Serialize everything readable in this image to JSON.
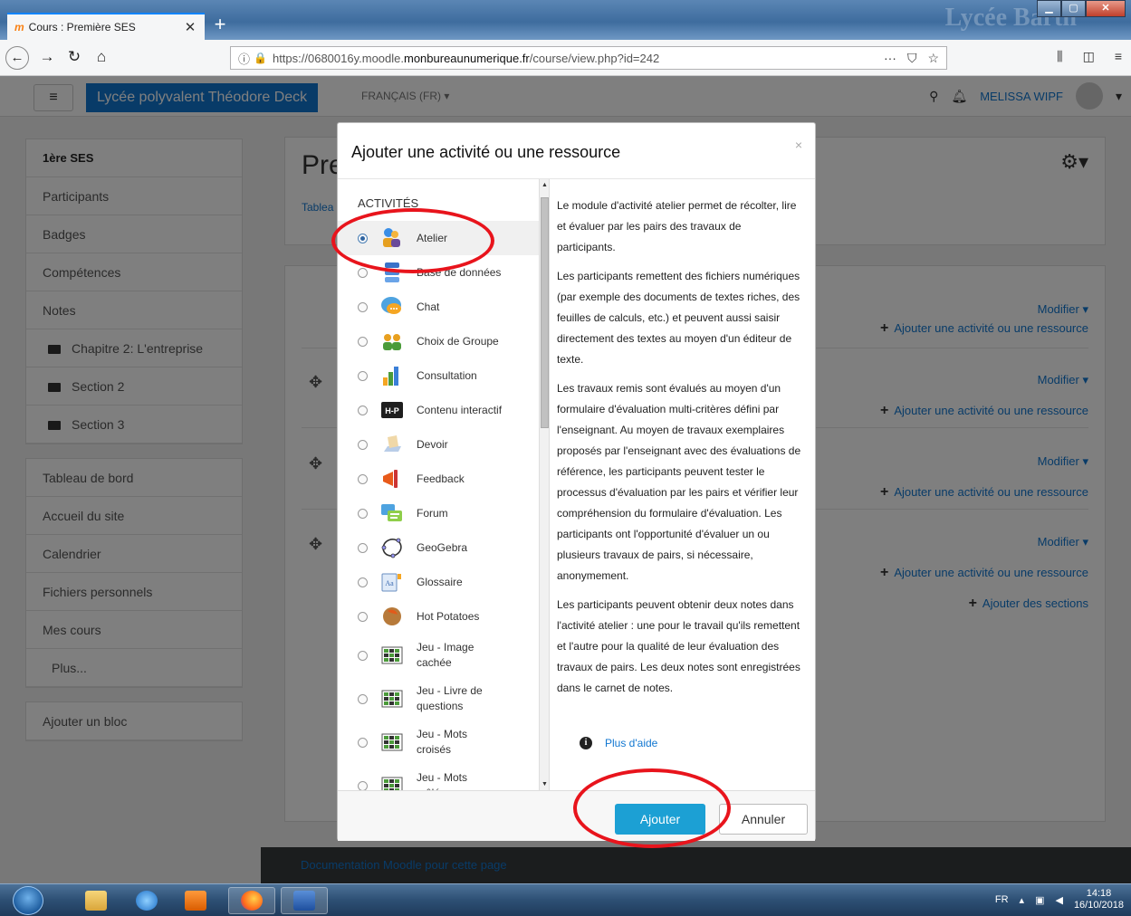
{
  "browser": {
    "tab_title": "Cours : Première SES",
    "tab_favicon": "m",
    "url_prefix": "https://0680016y.moodle.",
    "url_domain": "monbureaunumerique.fr",
    "url_path": "/course/view.php?id=242",
    "url_menu": "···",
    "watermark": "Lycée Barth"
  },
  "moodle": {
    "brand": "Lycée polyvalent Théodore Deck",
    "lang": "FRANÇAIS (FR) ▾",
    "user": "MELISSA WIPF",
    "page_title": "Pre",
    "breadcrumb": "Tablea",
    "footer_doc": "Documentation Moodle pour cette page",
    "sidebar_primary": [
      {
        "label": "1ère SES"
      },
      {
        "label": "Participants"
      },
      {
        "label": "Badges"
      },
      {
        "label": "Compétences"
      },
      {
        "label": "Notes"
      },
      {
        "label": "Chapitre 2: L'entreprise"
      },
      {
        "label": "Section 2"
      },
      {
        "label": "Section 3"
      }
    ],
    "sidebar_secondary": [
      {
        "label": "Tableau de bord"
      },
      {
        "label": "Accueil du site"
      },
      {
        "label": "Calendrier"
      },
      {
        "label": "Fichiers personnels"
      },
      {
        "label": "Mes cours"
      },
      {
        "label": "Plus..."
      }
    ],
    "add_block": "Ajouter un bloc",
    "modifier": "Modifier ▾",
    "add_activity": "Ajouter une activité ou une ressource",
    "add_sections": "Ajouter des sections",
    "move_icon": "✥"
  },
  "modal": {
    "title": "Ajouter une activité ou une ressource",
    "close": "×",
    "section_header": "ACTIVITÉS",
    "options": [
      {
        "label": "Atelier",
        "icon": "workshop-icon",
        "selected": true
      },
      {
        "label": "Base de données",
        "icon": "database-icon"
      },
      {
        "label": "Chat",
        "icon": "chat-icon"
      },
      {
        "label": "Choix de Groupe",
        "icon": "group-choice-icon"
      },
      {
        "label": "Consultation",
        "icon": "feedback-chart-icon"
      },
      {
        "label": "Contenu interactif",
        "icon": "h5p-icon"
      },
      {
        "label": "Devoir",
        "icon": "assignment-icon"
      },
      {
        "label": "Feedback",
        "icon": "megaphone-icon"
      },
      {
        "label": "Forum",
        "icon": "forum-icon"
      },
      {
        "label": "GeoGebra",
        "icon": "geogebra-icon"
      },
      {
        "label": "Glossaire",
        "icon": "glossary-icon"
      },
      {
        "label": "Hot Potatoes",
        "icon": "hotpotatoes-icon"
      },
      {
        "label": "Jeu - Image cachée",
        "icon": "game-icon"
      },
      {
        "label": "Jeu - Livre de questions",
        "icon": "game-icon"
      },
      {
        "label": "Jeu - Mots croisés",
        "icon": "game-icon"
      },
      {
        "label": "Jeu - Mots mêlés",
        "icon": "game-icon"
      }
    ],
    "description": [
      "Le module d'activité atelier permet de récolter, lire et évaluer par les pairs des travaux de participants.",
      "Les participants remettent des fichiers numériques (par exemple des documents de textes riches, des feuilles de calculs, etc.) et peuvent aussi saisir directement des textes au moyen d'un éditeur de texte.",
      "Les travaux remis sont évalués au moyen d'un formulaire d'évaluation multi-critères défini par l'enseignant. Au moyen de travaux exemplaires proposés par l'enseignant avec des évaluations de référence, les participants peuvent tester le processus d'évaluation par les pairs et vérifier leur compréhension du formulaire d'évaluation. Les participants ont l'opportunité d'évaluer un ou plusieurs travaux de pairs, si nécessaire, anonymement.",
      "Les participants peuvent obtenir deux notes dans l'activité atelier : une pour le travail qu'ils remettent et l'autre pour la qualité de leur évaluation des travaux de pairs. Les deux notes sont enregistrées dans le carnet de notes."
    ],
    "help_link": "Plus d'aide",
    "add_button": "Ajouter",
    "cancel_button": "Annuler"
  },
  "taskbar": {
    "lang": "FR",
    "time": "14:18",
    "date": "16/10/2018"
  }
}
